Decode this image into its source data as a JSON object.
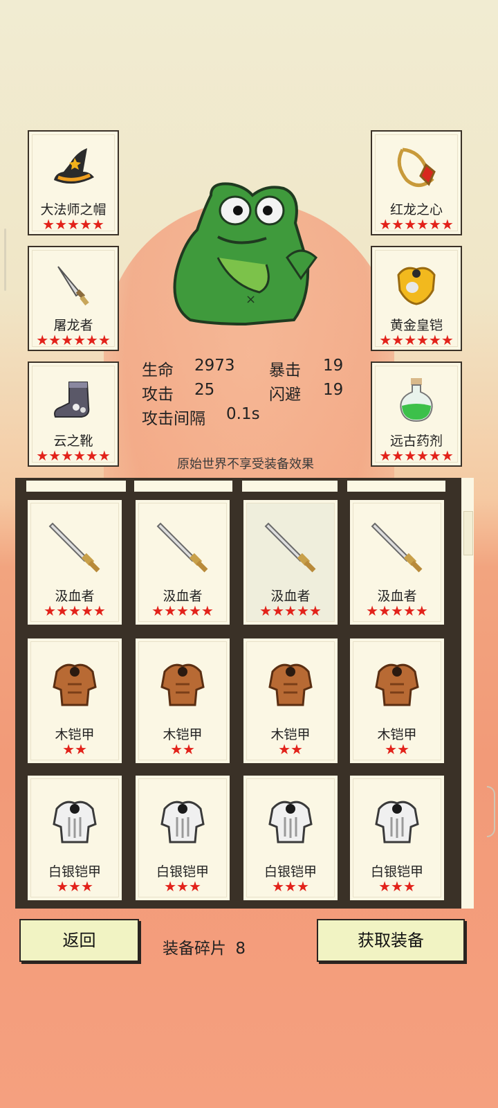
{
  "equipped_left": [
    {
      "name": "大法师之帽",
      "stars": "★★★★★",
      "icon": "wizard-hat-icon"
    },
    {
      "name": "屠龙者",
      "stars": "★★★★★★",
      "icon": "dagger-icon"
    },
    {
      "name": "云之靴",
      "stars": "★★★★★★",
      "icon": "boot-icon"
    }
  ],
  "equipped_right": [
    {
      "name": "红龙之心",
      "stars": "★★★★★★",
      "icon": "amulet-icon"
    },
    {
      "name": "黄金皇铠",
      "stars": "★★★★★★",
      "icon": "gold-armor-icon"
    },
    {
      "name": "远古药剂",
      "stars": "★★★★★★",
      "icon": "potion-icon"
    }
  ],
  "stats": {
    "hp_label": "生命",
    "hp": "2973",
    "crit_label": "暴击",
    "crit": "19",
    "atk_label": "攻击",
    "atk": "25",
    "dodge_label": "闪避",
    "dodge": "19",
    "interval_label": "攻击间隔",
    "interval": "0.1s"
  },
  "notice": "原始世界不享受装备效果",
  "inventory": [
    {
      "name": "汲血者",
      "stars": "★★★★★",
      "icon": "sword-icon"
    },
    {
      "name": "汲血者",
      "stars": "★★★★★",
      "icon": "sword-icon"
    },
    {
      "name": "汲血者",
      "stars": "★★★★★",
      "icon": "sword-icon"
    },
    {
      "name": "汲血者",
      "stars": "★★★★★",
      "icon": "sword-icon"
    },
    {
      "name": "木铠甲",
      "stars": "★★",
      "icon": "wood-armor-icon"
    },
    {
      "name": "木铠甲",
      "stars": "★★",
      "icon": "wood-armor-icon"
    },
    {
      "name": "木铠甲",
      "stars": "★★",
      "icon": "wood-armor-icon"
    },
    {
      "name": "木铠甲",
      "stars": "★★",
      "icon": "wood-armor-icon"
    },
    {
      "name": "白银铠甲",
      "stars": "★★★",
      "icon": "silver-armor-icon"
    },
    {
      "name": "白银铠甲",
      "stars": "★★★",
      "icon": "silver-armor-icon"
    },
    {
      "name": "白银铠甲",
      "stars": "★★★",
      "icon": "silver-armor-icon"
    },
    {
      "name": "白银铠甲",
      "stars": "★★★",
      "icon": "silver-armor-icon"
    }
  ],
  "buttons": {
    "back": "返回",
    "get_equipment": "获取装备"
  },
  "fragments": {
    "label": "装备碎片",
    "count": "8"
  },
  "colors": {
    "star": "#e2221a",
    "card_bg": "#fbf7e4",
    "button_bg": "#f1f3c3",
    "frog": "#3f9a3c"
  }
}
